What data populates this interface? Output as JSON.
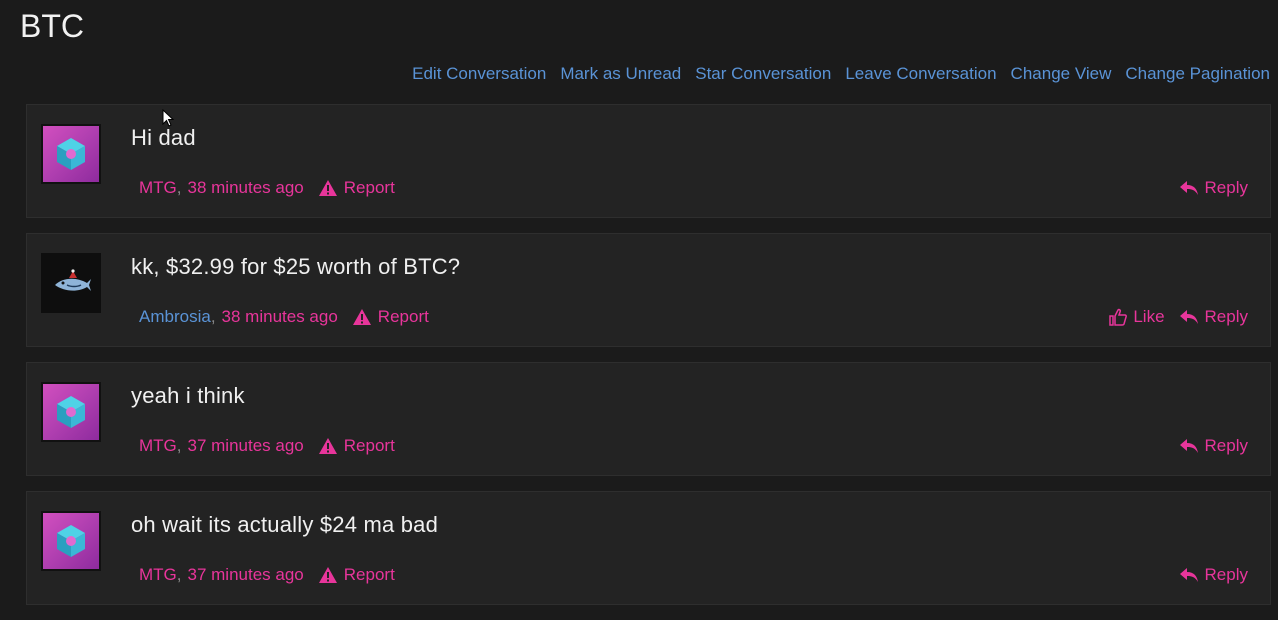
{
  "page": {
    "title": "BTC"
  },
  "actions": [
    "Edit Conversation",
    "Mark as Unread",
    "Star Conversation",
    "Leave Conversation",
    "Change View",
    "Change Pagination"
  ],
  "messages": [
    {
      "text": "Hi dad",
      "author": "MTG",
      "time": "38 minutes ago",
      "report": "Report",
      "like": "",
      "reply": "Reply"
    },
    {
      "text": "kk, $32.99 for $25 worth of BTC?",
      "author": "Ambrosia",
      "time": "38 minutes ago",
      "report": "Report",
      "like": "Like",
      "reply": "Reply"
    },
    {
      "text": "yeah i think",
      "author": "MTG",
      "time": "37 minutes ago",
      "report": "Report",
      "like": "",
      "reply": "Reply"
    },
    {
      "text": "oh wait its actually $24 ma bad",
      "author": "MTG",
      "time": "37 minutes ago",
      "report": "Report",
      "like": "",
      "reply": "Reply"
    }
  ],
  "colors": {
    "accent_pink": "#e8359b",
    "link_blue": "#5a93d6",
    "background": "#1b1b1b",
    "card": "#232323"
  },
  "icons": {
    "report": "warning-triangle-icon",
    "reply": "reply-arrow-icon",
    "like": "thumbs-up-icon"
  }
}
